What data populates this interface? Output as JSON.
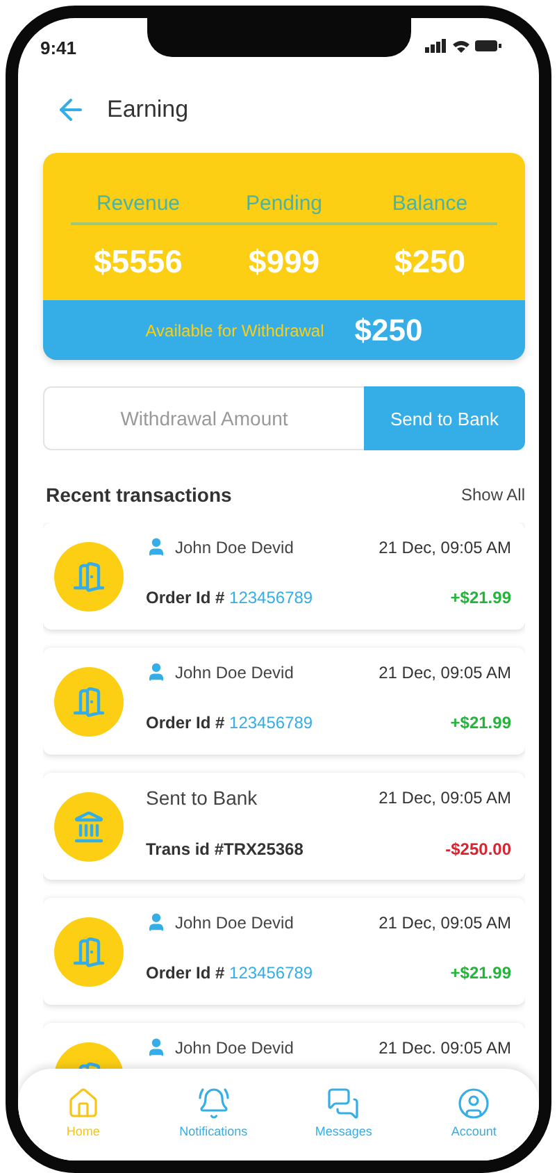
{
  "status_bar": {
    "time": "9:41"
  },
  "header": {
    "title": "Earning"
  },
  "summary": {
    "stats": [
      {
        "label": "Revenue",
        "value": "$5556"
      },
      {
        "label": "Pending",
        "value": "$999"
      },
      {
        "label": "Balance",
        "value": "$250"
      }
    ],
    "available": {
      "label": "Available for Withdrawal",
      "value": "$250"
    }
  },
  "withdraw": {
    "placeholder": "Withdrawal Amount",
    "button": "Send to Bank"
  },
  "transactions": {
    "title": "Recent transactions",
    "show_all": "Show All",
    "items": [
      {
        "kind": "order",
        "name": "John Doe Devid",
        "date": "21 Dec, 09:05 AM",
        "id_label": "Order Id #",
        "id": "123456789",
        "amount": "+$21.99",
        "color": "#22b53a"
      },
      {
        "kind": "order",
        "name": "John Doe Devid",
        "date": "21 Dec, 09:05 AM",
        "id_label": "Order Id #",
        "id": "123456789",
        "amount": "+$21.99",
        "color": "#22b53a"
      },
      {
        "kind": "bank",
        "name": "Sent to Bank",
        "date": "21 Dec, 09:05 AM",
        "id_label": "Trans id #TRX25368",
        "amount": "-$250.00",
        "color": "#d9232e"
      },
      {
        "kind": "order",
        "name": "John Doe Devid",
        "date": "21 Dec, 09:05 AM",
        "id_label": "Order Id #",
        "id": "123456789",
        "amount": "+$21.99",
        "color": "#22b53a"
      },
      {
        "kind": "order",
        "name": "John Doe Devid",
        "date": "21 Dec. 09:05 AM"
      }
    ]
  },
  "nav": [
    {
      "kind": "home",
      "label": "Home",
      "selected": true
    },
    {
      "kind": "notifications",
      "label": "Notifications",
      "selected": false
    },
    {
      "kind": "messages",
      "label": "Messages",
      "selected": false
    },
    {
      "kind": "account",
      "label": "Account",
      "selected": false
    }
  ]
}
